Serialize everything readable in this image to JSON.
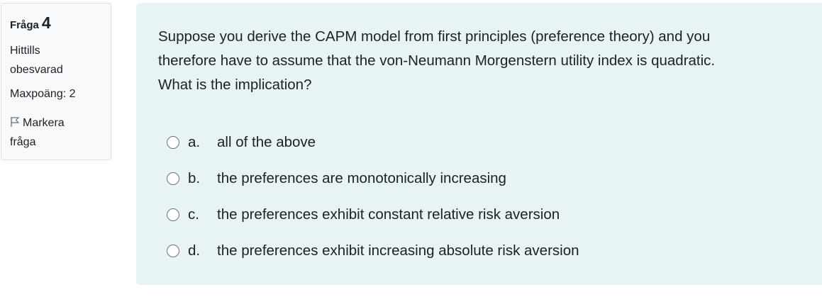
{
  "info": {
    "question_label": "Fråga",
    "question_number": "4",
    "state_line1": "Hittills",
    "state_line2": "obesvarad",
    "max_points": "Maxpoäng: 2",
    "flag_line1": "Markera",
    "flag_line2": "fråga",
    "flag_icon": "flag-icon"
  },
  "question": {
    "text_line1": "Suppose you derive the CAPM model from first principles (preference theory) and you",
    "text_line2": "therefore have to assume that the von-Neumann Morgenstern utility index is quadratic.",
    "text_line3": "What is the implication?",
    "answers": [
      {
        "letter": "a.",
        "text": "all of the above"
      },
      {
        "letter": "b.",
        "text": "the preferences are monotonically increasing"
      },
      {
        "letter": "c.",
        "text": "the preferences exhibit constant relative risk aversion"
      },
      {
        "letter": "d.",
        "text": "the preferences exhibit increasing absolute risk aversion"
      }
    ]
  },
  "colors": {
    "content_bg": "#e7f3f5",
    "info_bg": "#f8f9fa",
    "text": "#1d2125"
  }
}
